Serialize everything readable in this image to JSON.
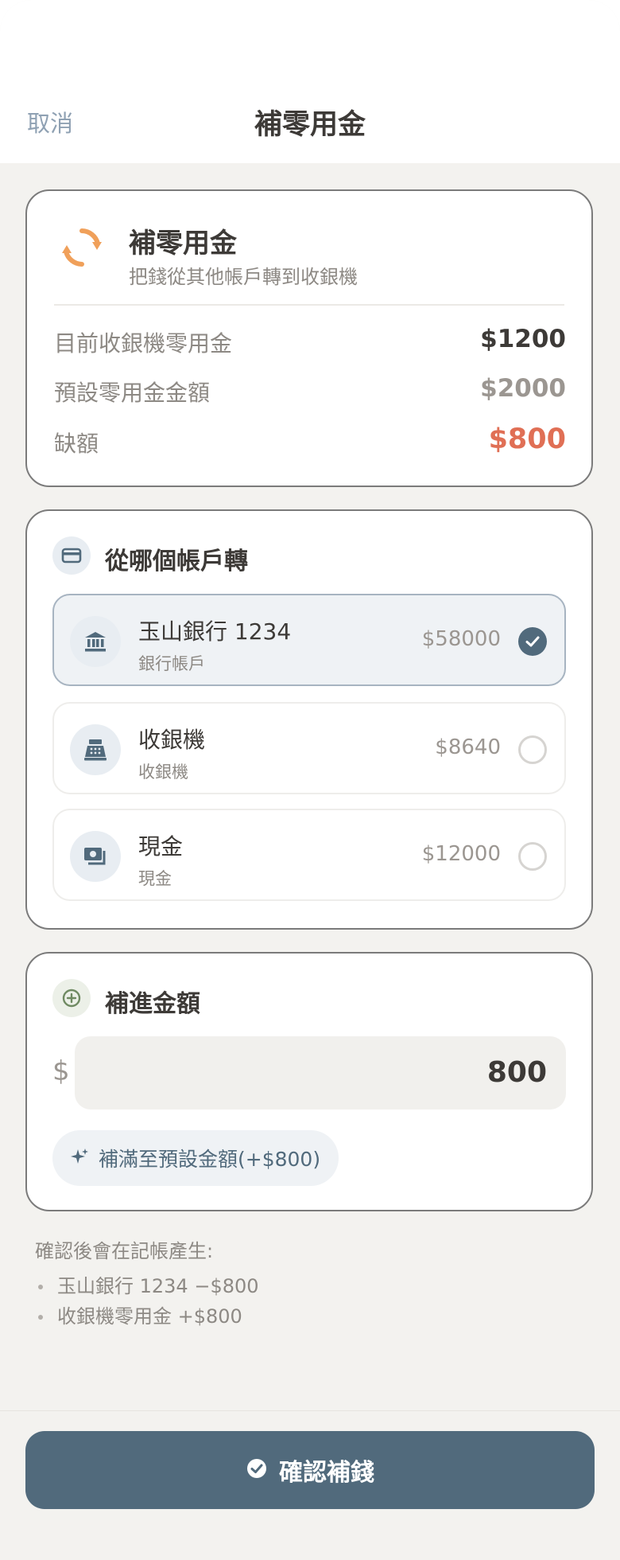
{
  "header": {
    "cancel_label": "取消",
    "title": "補零用金"
  },
  "summary": {
    "title": "補零用金",
    "subtitle": "把錢從其他帳戶轉到收銀機",
    "rows": [
      {
        "label": "目前收銀機零用金",
        "value": "$1200"
      },
      {
        "label": "預設零用金金額",
        "value": "$2000"
      },
      {
        "label": "缺額",
        "value": "$800"
      }
    ],
    "accent_color": "#f0a05a",
    "shortfall_color": "#e06f55"
  },
  "source": {
    "title": "從哪個帳戶轉",
    "accounts": [
      {
        "name": "玉山銀行 1234",
        "type": "銀行帳戶",
        "balance": "$58000",
        "selected": true,
        "icon": "bank-icon"
      },
      {
        "name": "收銀機",
        "type": "收銀機",
        "balance": "$8640",
        "selected": false,
        "icon": "cash-register-icon"
      },
      {
        "name": "現金",
        "type": "現金",
        "balance": "$12000",
        "selected": false,
        "icon": "cash-icon"
      }
    ]
  },
  "amount": {
    "title": "補進金額",
    "currency_symbol": "$",
    "value": "800",
    "fill_button_label": "補滿至預設金額(+$800)"
  },
  "note": {
    "heading": "確認後會在記帳產生:",
    "items": [
      "玉山銀行 1234 −$800",
      "收銀機零用金 +$800"
    ]
  },
  "footer": {
    "confirm_label": "確認補錢"
  },
  "colors": {
    "primary": "#516a7c",
    "background": "#f3f2ef"
  }
}
